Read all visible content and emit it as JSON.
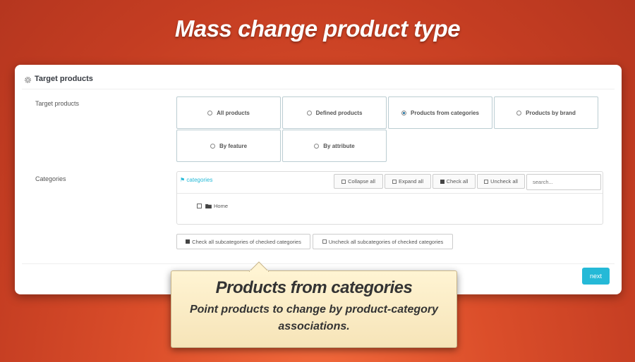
{
  "headline": "Mass change product type",
  "panel": {
    "title": "Target products",
    "target_label": "Target products",
    "categories_label": "Categories",
    "options": [
      {
        "label": "All products",
        "selected": false
      },
      {
        "label": "Defined products",
        "selected": false
      },
      {
        "label": "Products from categories",
        "selected": true
      },
      {
        "label": "Products by brand",
        "selected": false
      },
      {
        "label": "By feature",
        "selected": false
      },
      {
        "label": "By attribute",
        "selected": false
      }
    ],
    "tree": {
      "tag_label": "categories",
      "collapse_all": "Collapse all",
      "expand_all": "Expand all",
      "check_all": "Check all",
      "uncheck_all": "Uncheck all",
      "search_placeholder": "search...",
      "root_item": "Home"
    },
    "check_sub": "Check all subcategories of checked categories",
    "uncheck_sub": "Uncheck all subcategories of checked categories",
    "next_label": "next"
  },
  "callout": {
    "title": "Products from categories",
    "text": "Point products to change by product-category associations."
  },
  "colors": {
    "accent": "#25b9d7",
    "background": "#d44a27",
    "callout_bg": "#f8eac5"
  }
}
